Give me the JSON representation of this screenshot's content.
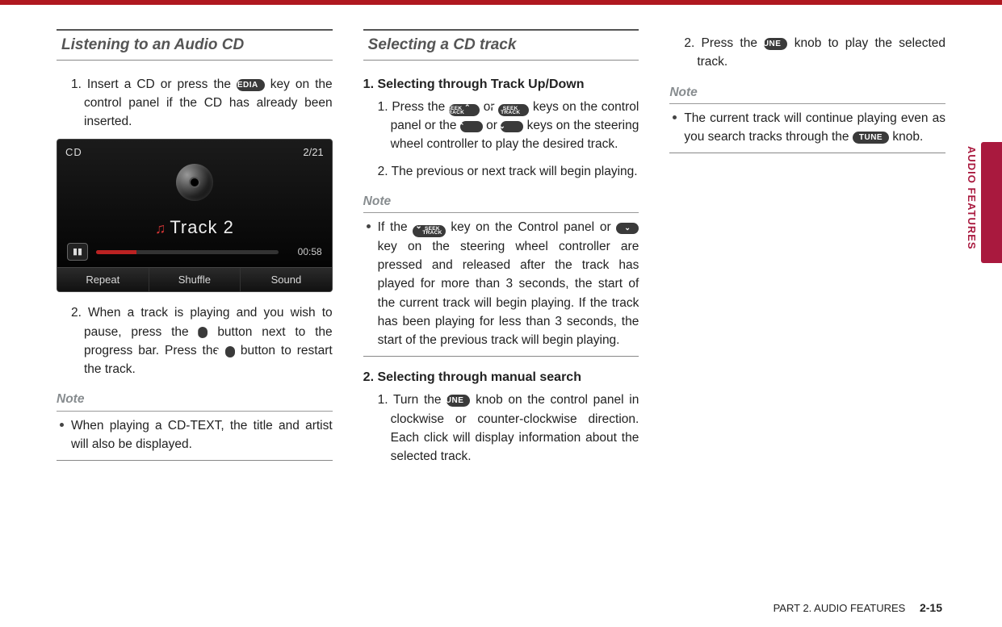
{
  "sideTab": {
    "label": "AUDIO FEATURES"
  },
  "footer": {
    "part": "PART 2. AUDIO FEATURES",
    "page": "2-15"
  },
  "buttons": {
    "media": "MEDIA",
    "tune": "TUNE",
    "pause": "▮▮",
    "play": "▶",
    "seekUp1": "SEEK",
    "seekUp2": "TRACK",
    "seekDown1": "SEEK",
    "seekDown2": "TRACK",
    "chevUp": "⌃",
    "chevDown": "⌄"
  },
  "col1": {
    "heading": "Listening to an Audio CD",
    "step1a": "1. Insert a CD or press the ",
    "step1b": " key on the control panel if the CD has already been inserted.",
    "step2a": "2. When a track is playing and you wish to pause, press the ",
    "step2b": " button next to the progress bar. Press the ",
    "step2c": " button to restart the track.",
    "noteLabel": "Note",
    "noteItem": "When playing a CD-TEXT, the title and artist will also be displayed."
  },
  "screenshot": {
    "mode": "CD",
    "count": "2/21",
    "track": "Track 2",
    "time": "00:58",
    "btnRepeat": "Repeat",
    "btnShuffle": "Shuffle",
    "btnSound": "Sound"
  },
  "col2": {
    "heading": "Selecting a CD track",
    "sub1": "1. Selecting through Track Up/Down",
    "s1_1a": "1. Press the ",
    "s1_1b": " or ",
    "s1_1c": " keys on the control panel or the ",
    "s1_1d": " or ",
    "s1_1e": " keys on the steering wheel controller to play the desired track.",
    "s1_2": "2. The previous or next track will begin playing.",
    "noteLabel": "Note",
    "note1a": "If the ",
    "note1b": " key on the Control panel or ",
    "note1c": " key on the steering wheel controller are pressed and released after the track has played for more than 3 seconds, the start of the current track will begin playing. If the track has been playing for less than 3 seconds, the start of the previous track will begin playing.",
    "sub2": "2. Selecting through manual search",
    "s2_1a": "1. Turn the ",
    "s2_1b": " knob on the control panel in clockwise or counter-clockwise direction. Each click will display information about the selected track."
  },
  "col3": {
    "s2_2a": "2. Press the ",
    "s2_2b": " knob to play the selected track.",
    "noteLabel": "Note",
    "note1a": "The current track will continue playing even as you search tracks through the ",
    "note1b": " knob."
  }
}
